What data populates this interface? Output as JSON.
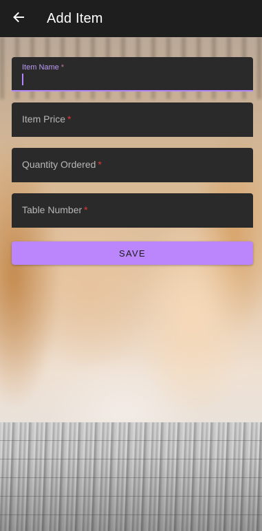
{
  "app_bar": {
    "title": "Add Item",
    "back_icon": "arrow-left-icon"
  },
  "form": {
    "fields": [
      {
        "label": "Item Name",
        "required_mark": "*",
        "value": "",
        "focused": true
      },
      {
        "label": "Item Price",
        "required_mark": "*",
        "value": "",
        "focused": false
      },
      {
        "label": "Quantity Ordered",
        "required_mark": "*",
        "value": "",
        "focused": false
      },
      {
        "label": "Table Number",
        "required_mark": "*",
        "value": "",
        "focused": false
      }
    ],
    "save_label": "SAVE"
  },
  "colors": {
    "accent": "#bb86fc",
    "app_bar": "#1e1e1e",
    "field_bg": "#2a2a2a",
    "required": "#e53935"
  }
}
